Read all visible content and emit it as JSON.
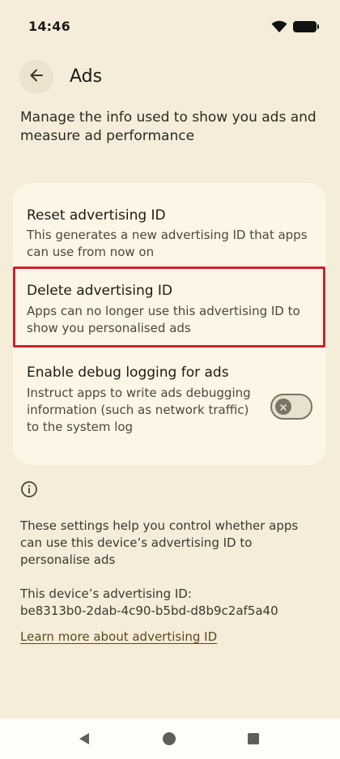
{
  "status_bar": {
    "time": "14:46"
  },
  "header": {
    "title": "Ads"
  },
  "description": "Manage the info used to show you ads and measure ad performance",
  "settings": {
    "reset": {
      "title": "Reset advertising ID",
      "subtitle": "This generates a new advertising ID that apps can use from now on"
    },
    "delete": {
      "title": "Delete advertising ID",
      "subtitle": "Apps can no longer use this advertising ID to show you personalised ads"
    },
    "debug": {
      "title": "Enable debug logging for ads",
      "subtitle": "Instruct apps to write ads debugging information (such as network traffic) to the system log",
      "enabled": false
    }
  },
  "info": {
    "text": "These settings help you control whether apps can use this device’s advertising ID to personalise ads",
    "id_label": "This device’s advertising ID:",
    "id_value": "be8313b0-2dab-4c90-b5bd-d8b9c2af5a40",
    "learn_more": "Learn more about advertising ID"
  },
  "colors": {
    "background": "#f5ecd9",
    "card": "#fdf6e6",
    "highlight_border": "#d0202c",
    "link": "#5d4a1f"
  }
}
